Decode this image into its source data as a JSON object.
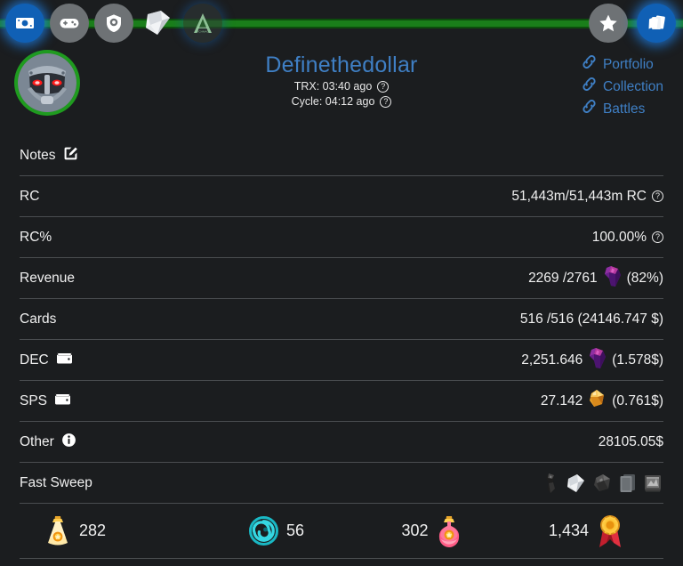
{
  "topbar": {
    "left_icons": [
      {
        "name": "money-icon",
        "label": "Money",
        "state": "active"
      },
      {
        "name": "gamepad-icon",
        "label": "Battles",
        "state": "normal"
      },
      {
        "name": "shield-icon",
        "label": "Guild",
        "state": "normal"
      },
      {
        "name": "cards-icon",
        "label": "Cards",
        "state": "normal"
      },
      {
        "name": "letter-a-logo-icon",
        "label": "Archmage",
        "state": "ghost"
      }
    ],
    "right_icons": [
      {
        "name": "star-icon",
        "label": "Favorites",
        "state": "normal"
      },
      {
        "name": "card-stack-icon",
        "label": "Collection",
        "state": "active"
      }
    ]
  },
  "profile": {
    "username": "Definethedollar",
    "avatar_name": "robot-avatar",
    "trx_label": "TRX: 03:40 ago",
    "cycle_label": "Cycle: 04:12 ago",
    "help_glyph": "?"
  },
  "links": [
    {
      "label": "Portfolio",
      "icon": "link-chain-icon"
    },
    {
      "label": "Collection",
      "icon": "link-chain-icon"
    },
    {
      "label": "Battles",
      "icon": "link-chain-icon"
    }
  ],
  "rows": {
    "notes": {
      "label": "Notes",
      "icon": "edit-pencil-icon"
    },
    "rc": {
      "label": "RC",
      "value": "51,443m/51,443m RC",
      "help": "?"
    },
    "rc_percent": {
      "label": "RC%",
      "value": "100.00%",
      "help": "?"
    },
    "revenue": {
      "label": "Revenue",
      "value": "2269 /2761",
      "suffix": "(82%)",
      "icon": "dec-crystal-icon"
    },
    "cards": {
      "label": "Cards",
      "value": "516 /516 (24146.747 $)"
    },
    "dec": {
      "label": "DEC",
      "label_icon": "wallet-icon",
      "value": "2,251.646",
      "suffix": "(1.578$)",
      "icon": "dec-crystal-icon"
    },
    "sps": {
      "label": "SPS",
      "label_icon": "wallet-icon",
      "value": "27.142",
      "suffix": "(0.761$)",
      "icon": "sps-crystal-icon"
    },
    "other": {
      "label": "Other",
      "label_icon": "info-icon",
      "value": "28105.05$"
    },
    "fast_sweep": {
      "label": "Fast Sweep",
      "icons": [
        {
          "name": "sweep-item-dark-icon"
        },
        {
          "name": "sweep-item-paper-icon"
        },
        {
          "name": "sweep-item-rock-icon"
        },
        {
          "name": "sweep-item-card-icon"
        },
        {
          "name": "sweep-item-scroll-icon"
        }
      ]
    }
  },
  "resources": [
    {
      "name": "potion-gold-icon",
      "value": "282",
      "order": "icon-first"
    },
    {
      "name": "glint-spiral-icon",
      "value": "56",
      "order": "icon-first"
    },
    {
      "name": "potion-pink-icon",
      "value": "302",
      "order": "value-first"
    },
    {
      "name": "merit-medal-icon",
      "value": "1,434",
      "order": "value-first"
    }
  ],
  "colors": {
    "background": "#1b1d1f",
    "accent_green": "#1a7e1a",
    "link_blue": "#3f7fc4",
    "active_blue": "#1060b5",
    "divider": "#4a4d50",
    "text": "#f0f0f0"
  }
}
